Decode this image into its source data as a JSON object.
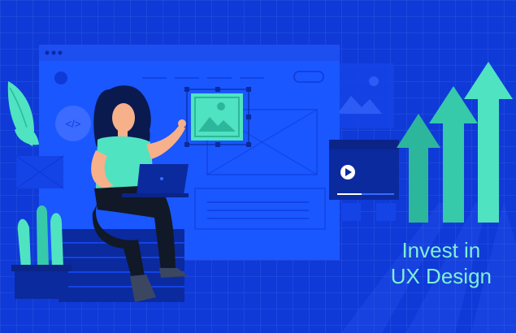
{
  "headline": {
    "line1": "Invest in",
    "line2": "UX Design"
  },
  "colors": {
    "background": "#0f3ad8",
    "window": "#1a57ff",
    "accent": "#4fe3c1",
    "arrow_dark": "#2cb79c",
    "dark_navy": "#0b2a9e"
  },
  "icons": [
    "code-icon",
    "image-icon",
    "play-icon",
    "leaf-icon",
    "cactus-icon",
    "growth-arrow-icon",
    "laptop-icon"
  ]
}
